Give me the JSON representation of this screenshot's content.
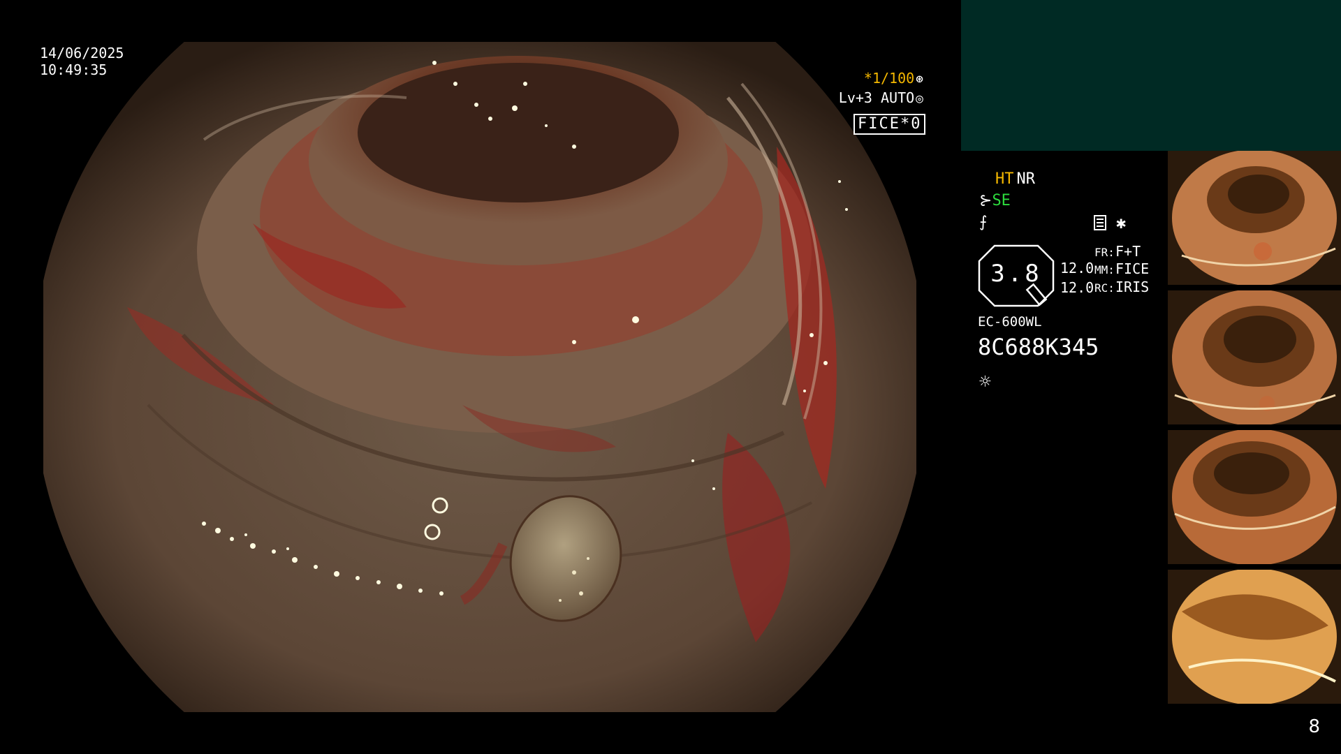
{
  "overlay": {
    "date": "14/06/2025",
    "time": "10:49:35",
    "shutter": "*1/100",
    "level": "Lv+3 AUTO",
    "mode_box": "FICE*0"
  },
  "panel": {
    "ht": "HT",
    "nr": "NR",
    "se": "SE",
    "zoom": "3.8",
    "num1": "12.0",
    "num2": "12.0",
    "fr_label": "FR:",
    "fr_value": "F+T",
    "mm_label": "MM:",
    "mm_value": "FICE",
    "rc_label": "RC:",
    "rc_value": "IRIS",
    "scope_model": "EC-600WL",
    "scope_serial": "8C688K345"
  },
  "thumbnails": [
    {
      "name": "captured-image-1"
    },
    {
      "name": "captured-image-2"
    },
    {
      "name": "captured-image-3"
    },
    {
      "name": "captured-image-4"
    }
  ],
  "page_number": "8",
  "colors": {
    "accent_yellow": "#f5b800",
    "accent_green": "#2ddc3d",
    "panel_teal": "#002a24"
  },
  "icons": [
    "shutter-icon",
    "auto-iris-icon",
    "scope-angle-icon",
    "structure-icon",
    "record-icon",
    "star-icon",
    "light-icon"
  ]
}
